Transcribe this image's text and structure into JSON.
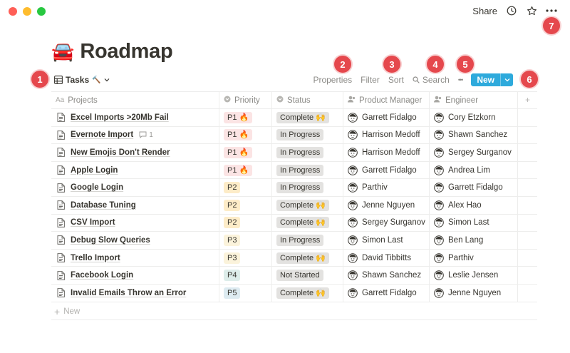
{
  "window": {
    "colors": {
      "close": "#ff5f57",
      "minimize": "#febc2e",
      "zoom": "#28c840"
    }
  },
  "topbar": {
    "share_label": "Share",
    "icons": [
      "clock-icon",
      "star-icon",
      "more-icon"
    ]
  },
  "page": {
    "emoji": "🚘",
    "title": "Roadmap"
  },
  "view": {
    "label": "Tasks",
    "suffix": "🔨"
  },
  "toolbar": {
    "properties": "Properties",
    "filter": "Filter",
    "sort": "Sort",
    "search": "Search",
    "more": "•••",
    "new_label": "New",
    "new_color": "#2eaadc"
  },
  "annotations": [
    "1",
    "2",
    "3",
    "4",
    "5",
    "6",
    "7"
  ],
  "table": {
    "columns": {
      "projects": "Projects",
      "priority": "Priority",
      "status": "Status",
      "product_manager": "Product Manager",
      "engineer": "Engineer",
      "add": "+"
    },
    "rows": [
      {
        "project": "Excel Imports >20Mb Fail",
        "comments": "",
        "priority": "P1 🔥",
        "status": "Complete 🙌",
        "pm": "Garrett Fidalgo",
        "engineer": "Cory Etzkorn"
      },
      {
        "project": "Evernote Import",
        "comments": "1",
        "priority": "P1 🔥",
        "status": "In Progress",
        "pm": "Harrison Medoff",
        "engineer": "Shawn Sanchez"
      },
      {
        "project": "New Emojis Don't Render",
        "comments": "",
        "priority": "P1 🔥",
        "status": "In Progress",
        "pm": "Harrison Medoff",
        "engineer": "Sergey Surganov"
      },
      {
        "project": "Apple Login",
        "comments": "",
        "priority": "P1 🔥",
        "status": "In Progress",
        "pm": "Garrett Fidalgo",
        "engineer": "Andrea Lim"
      },
      {
        "project": "Google Login",
        "comments": "",
        "priority": "P2",
        "status": "In Progress",
        "pm": "Parthiv",
        "engineer": "Garrett Fidalgo"
      },
      {
        "project": "Database Tuning",
        "comments": "",
        "priority": "P2",
        "status": "Complete 🙌",
        "pm": "Jenne Nguyen",
        "engineer": "Alex Hao"
      },
      {
        "project": "CSV Import",
        "comments": "",
        "priority": "P2",
        "status": "Complete 🙌",
        "pm": "Sergey Surganov",
        "engineer": "Simon Last"
      },
      {
        "project": "Debug Slow Queries",
        "comments": "",
        "priority": "P3",
        "status": "In Progress",
        "pm": "Simon Last",
        "engineer": "Ben Lang"
      },
      {
        "project": "Trello Import",
        "comments": "",
        "priority": "P3",
        "status": "Complete 🙌",
        "pm": "David Tibbitts",
        "engineer": "Parthiv"
      },
      {
        "project": "Facebook Login",
        "comments": "",
        "priority": "P4",
        "status": "Not Started",
        "pm": "Shawn Sanchez",
        "engineer": "Leslie Jensen"
      },
      {
        "project": "Invalid Emails Throw an Error",
        "comments": "",
        "priority": "P5",
        "status": "Complete 🙌",
        "pm": "Garrett Fidalgo",
        "engineer": "Jenne Nguyen"
      }
    ],
    "new_row_label": "New"
  }
}
